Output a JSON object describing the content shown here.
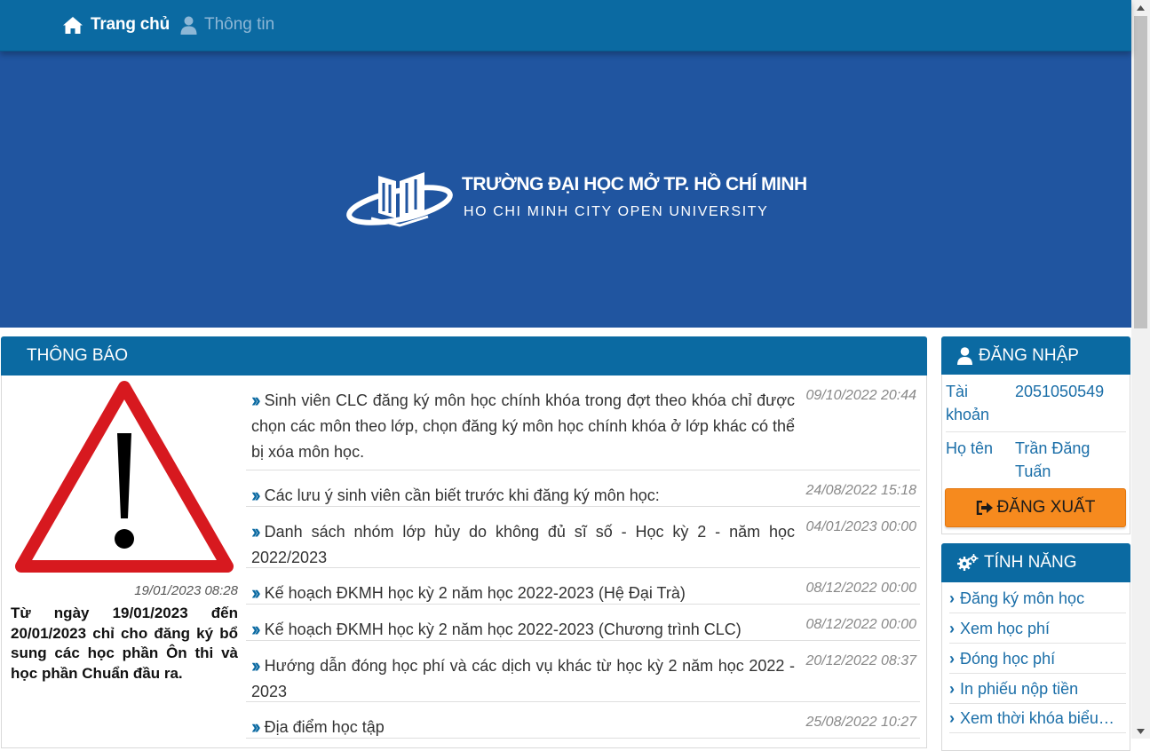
{
  "nav": {
    "home_label": "Trang chủ",
    "info_label": "Thông tin"
  },
  "banner": {
    "logo_title": "TRƯỜNG ĐẠI HỌC MỞ TP. HỒ CHÍ MINH",
    "logo_subtitle": "HO CHI MINH CITY OPEN UNIVERSITY"
  },
  "notices": {
    "header": "THÔNG BÁO",
    "featured": {
      "date": "19/01/2023 08:28",
      "text": "Từ ngày 19/01/2023 đến 20/01/2023 chỉ cho đăng ký bổ sung các học phần Ôn thi và học phần Chuẩn đầu ra."
    },
    "items": [
      {
        "title": "Sinh viên CLC đăng ký môn học chính khóa trong đợt theo khóa chỉ được chọn các môn theo lớp, chọn đăng ký môn học chính khóa ở lớp khác có thể bị xóa môn học.",
        "date": "09/10/2022 20:44"
      },
      {
        "title": "Các lưu ý sinh viên cần biết trước khi đăng ký môn học:",
        "date": "24/08/2022 15:18"
      },
      {
        "title": "Danh sách nhóm lớp hủy do không đủ sĩ số - Học kỳ 2 - năm học 2022/2023",
        "date": "04/01/2023 00:00"
      },
      {
        "title": "Kế hoạch ĐKMH học kỳ 2 năm học 2022-2023 (Hệ Đại Trà)",
        "date": "08/12/2022 00:00"
      },
      {
        "title": "Kế hoạch ĐKMH học kỳ 2 năm học 2022-2023 (Chương trình CLC)",
        "date": "08/12/2022 00:00"
      },
      {
        "title": "Hướng dẫn đóng học phí và các dịch vụ khác từ học kỳ 2 năm học 2022 - 2023",
        "date": "20/12/2022 08:37"
      },
      {
        "title": "Địa điểm học tập",
        "date": "25/08/2022 10:27"
      }
    ]
  },
  "login": {
    "header": "ĐĂNG NHẬP",
    "account_label": "Tài khoản",
    "account_value": "2051050549",
    "name_label": "Họ tên",
    "name_value": "Trần Đăng Tuấn",
    "logout_label": "ĐĂNG XUẤT"
  },
  "features": {
    "header": "TÍNH NĂNG",
    "items": [
      "Đăng ký môn học",
      "Xem học phí",
      "Đóng học phí",
      "In phiếu nộp tiền",
      "Xem thời khóa biểu…"
    ]
  },
  "icons": {
    "home": "home-icon",
    "user": "user-icon",
    "signout": "sign-out-icon",
    "gears": "gears-icon",
    "warning": "warning-triangle-icon",
    "chevron": "chevron-right-icon"
  },
  "colors": {
    "nav_bg": "#0b6aa2",
    "banner_bg": "#2055a0",
    "link_blue": "#1a6ea8",
    "logout_orange": "#f68a1e",
    "warning_red": "#d7191f"
  }
}
